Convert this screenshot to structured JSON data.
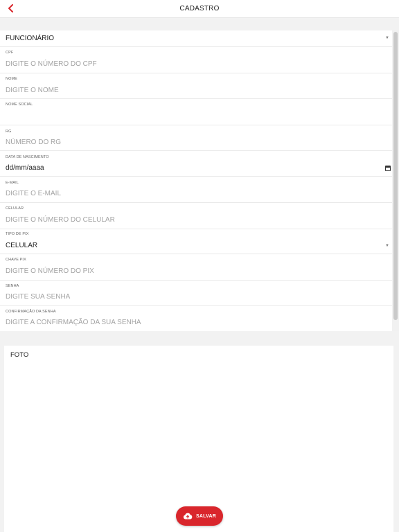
{
  "header": {
    "title": "CADASTRO"
  },
  "colors": {
    "accent": "#d9262c",
    "placeholder": "#a3a3a3",
    "background": "#f2f2f2"
  },
  "form": {
    "user_type": {
      "value": "FUNCIONÁRIO"
    },
    "cpf": {
      "label": "CPF",
      "placeholder": "DIGITE O NÚMERO DO CPF"
    },
    "nome": {
      "label": "NOME",
      "placeholder": "DIGITE O NOME"
    },
    "nome_social": {
      "label": "NOME SOCIAL",
      "placeholder": ""
    },
    "rg": {
      "label": "RG",
      "placeholder": "NÚMERO DO RG"
    },
    "data_nascimento": {
      "label": "DATA DE NASCIMENTO",
      "value": "dd/mm/aaaa"
    },
    "email": {
      "label": "E-MAIL",
      "placeholder": "DIGITE O E-MAIL"
    },
    "celular": {
      "label": "CELULAR",
      "placeholder": "DIGITE O NÚMERO DO CELULAR"
    },
    "tipo_pix": {
      "label": "TIPO DE PIX",
      "value": "CELULAR"
    },
    "chave_pix": {
      "label": "CHAVE PIX",
      "placeholder": "DIGITE O NÚMERO DO PIX"
    },
    "senha": {
      "label": "SENHA",
      "placeholder": "DIGITE SUA SENHA"
    },
    "confirmacao_senha": {
      "label": "CONFIRMAÇÃO DA SENHA",
      "placeholder": "DIGITE A CONFIRMAÇÃO DA SUA SENHA"
    }
  },
  "photo": {
    "label": "FOTO"
  },
  "actions": {
    "save_label": "SALVAR"
  },
  "icons": {
    "back": "chevron-left-icon",
    "calendar": "calendar-icon",
    "dropdown": "caret-down-icon",
    "save": "cloud-upload-icon"
  }
}
